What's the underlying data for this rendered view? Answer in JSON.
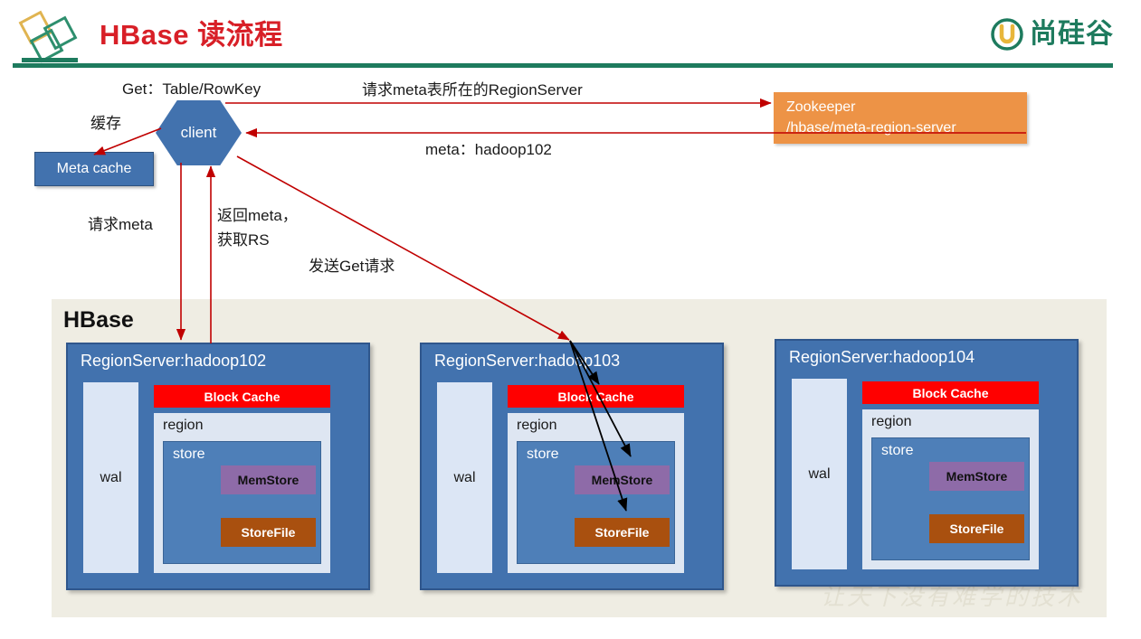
{
  "header": {
    "title": "HBase 读流程",
    "title_color": "#D81F27",
    "rule_color": "#1E7B5E",
    "logo_mark_name": "diamond-logo",
    "brand_text": "尚硅谷",
    "brand_color": "#1E7B5E"
  },
  "diagram": {
    "client": {
      "label": "client",
      "color": "#4272AE"
    },
    "meta_cache": {
      "label": "Meta cache",
      "color": "#4272AE"
    },
    "zookeeper": {
      "line1": "Zookeeper",
      "line2": "/hbase/meta-region-server",
      "color": "#ED9346"
    },
    "labels": {
      "get_request": "Get：Table/RowKey",
      "cache": "缓存",
      "request_meta_regionserver": "请求meta表所在的RegionServer",
      "meta_hadoop102": "meta：hadoop102",
      "request_meta": "请求meta",
      "return_meta_line1": "返回meta，",
      "return_meta_line2": "获取RS",
      "send_get_request": "发送Get请求"
    },
    "hbase": {
      "container_label": "HBase",
      "container_color": "#EFEDE3",
      "watermark": "让天下没有难学的技术",
      "region_servers": [
        {
          "title": "RegionServer:hadoop102",
          "wal": "wal",
          "block_cache": "Block Cache",
          "region": "region",
          "store": "store",
          "memstore": "MemStore",
          "storefile": "StoreFile"
        },
        {
          "title": "RegionServer:hadoop103",
          "wal": "wal",
          "block_cache": "Block Cache",
          "region": "region",
          "store": "store",
          "memstore": "MemStore",
          "storefile": "StoreFile"
        },
        {
          "title": "RegionServer:hadoop104",
          "wal": "wal",
          "block_cache": "Block Cache",
          "region": "region",
          "store": "store",
          "memstore": "MemStore",
          "storefile": "StoreFile"
        }
      ]
    },
    "colors": {
      "arrow_red": "#C00000",
      "arrow_black": "#000000",
      "block_cache": "#FF0000",
      "memstore": "#8E6BA8",
      "storefile": "#A9500F",
      "wal": "#DCE6F5",
      "region": "#DEE6F2",
      "store": "#4E7FB8"
    }
  }
}
